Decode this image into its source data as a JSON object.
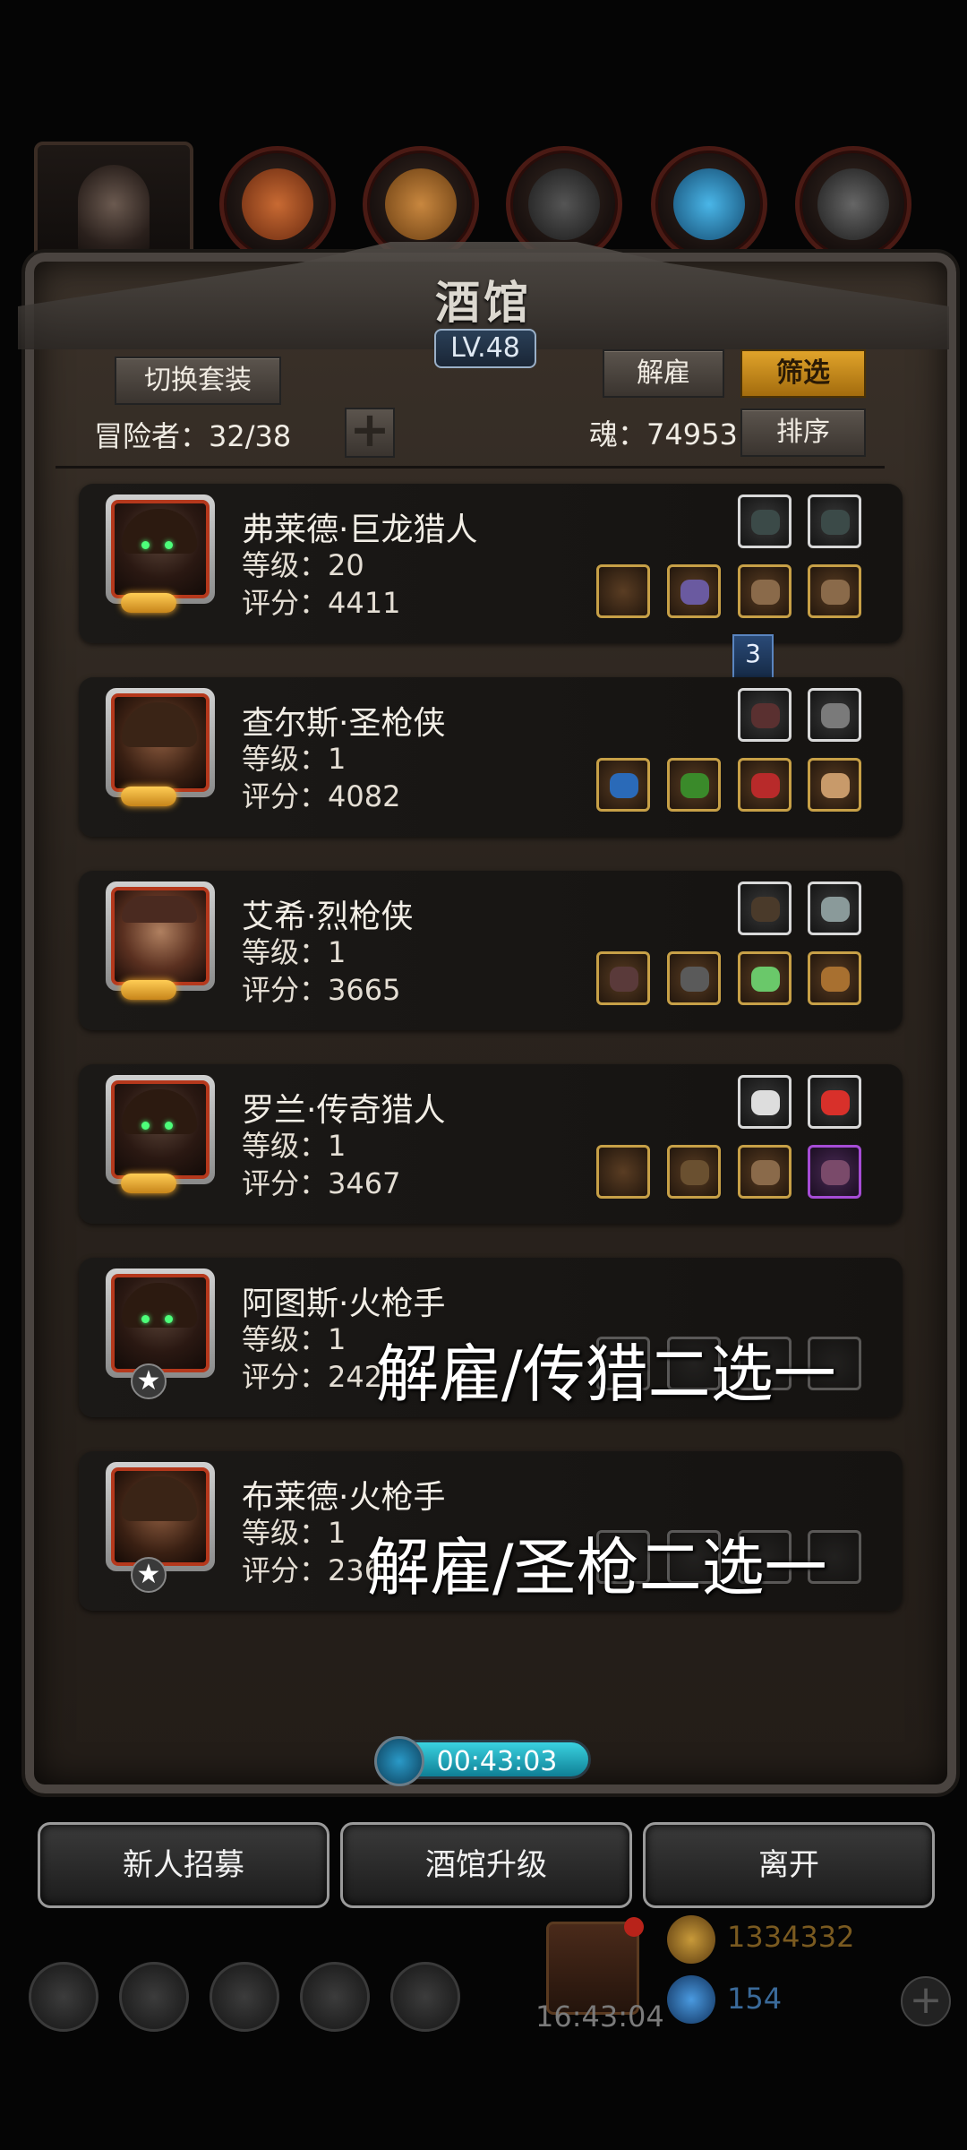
{
  "window": {
    "title": "酒馆",
    "level": "LV.48"
  },
  "toolbar": {
    "switch_outfit": "切换套装",
    "dismiss": "解雇",
    "filter": "筛选",
    "sort": "排序",
    "add": "+"
  },
  "stats": {
    "adventurers": "冒险者：32/38",
    "soul": "魂：74953"
  },
  "heroes": [
    {
      "name": "弗莱德·巨龙猎人",
      "level": "等级：20",
      "score": "评分：4411",
      "rank": "moon"
    },
    {
      "name": "查尔斯·圣枪侠",
      "level": "等级：1",
      "score": "评分：4082",
      "rank": "moon"
    },
    {
      "name": "艾希·烈枪侠",
      "level": "等级：1",
      "score": "评分：3665",
      "rank": "moon"
    },
    {
      "name": "罗兰·传奇猎人",
      "level": "等级：1",
      "score": "评分：3467",
      "rank": "moon"
    },
    {
      "name": "阿图斯·火枪手",
      "level": "等级：1",
      "score": "评分：242",
      "rank": "star"
    },
    {
      "name": "布莱德·火枪手",
      "level": "等级：1",
      "score": "评分：236",
      "rank": "star"
    }
  ],
  "equip_tag": "3",
  "annotations": [
    "解雇/传猎二选一",
    "解雇/圣枪二选一"
  ],
  "timer": "00:43:03",
  "actions": {
    "recruit": "新人招募",
    "upgrade": "酒馆升级",
    "leave": "离开"
  },
  "footer": {
    "clock": "16:43:04",
    "gold": "1334332",
    "gems": "154"
  },
  "colors": {
    "gold_button": "#e0a32a",
    "timer": "#3ad2e0",
    "frame": "#4a4440"
  }
}
